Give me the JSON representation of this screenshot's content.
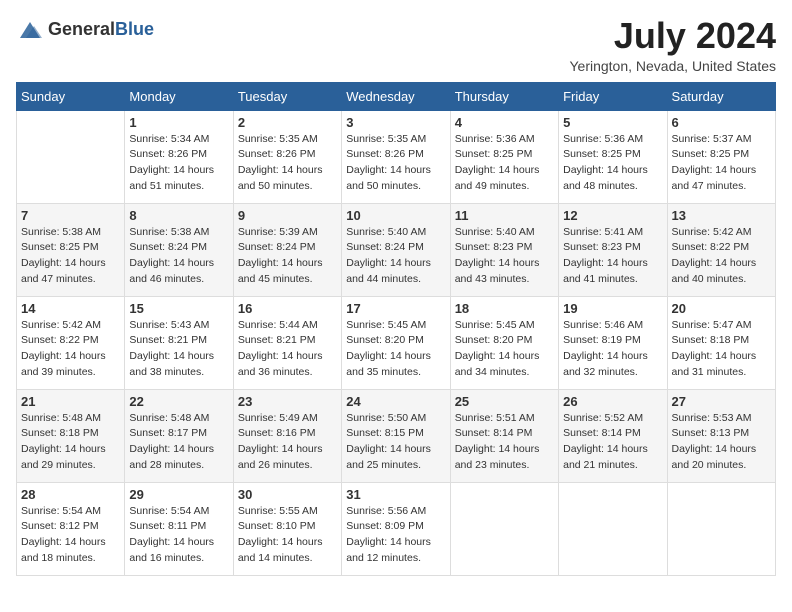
{
  "header": {
    "logo_general": "General",
    "logo_blue": "Blue",
    "month_year": "July 2024",
    "location": "Yerington, Nevada, United States"
  },
  "days_of_week": [
    "Sunday",
    "Monday",
    "Tuesday",
    "Wednesday",
    "Thursday",
    "Friday",
    "Saturday"
  ],
  "weeks": [
    [
      {
        "day": "",
        "sunrise": "",
        "sunset": "",
        "daylight": ""
      },
      {
        "day": "1",
        "sunrise": "Sunrise: 5:34 AM",
        "sunset": "Sunset: 8:26 PM",
        "daylight": "Daylight: 14 hours and 51 minutes."
      },
      {
        "day": "2",
        "sunrise": "Sunrise: 5:35 AM",
        "sunset": "Sunset: 8:26 PM",
        "daylight": "Daylight: 14 hours and 50 minutes."
      },
      {
        "day": "3",
        "sunrise": "Sunrise: 5:35 AM",
        "sunset": "Sunset: 8:26 PM",
        "daylight": "Daylight: 14 hours and 50 minutes."
      },
      {
        "day": "4",
        "sunrise": "Sunrise: 5:36 AM",
        "sunset": "Sunset: 8:25 PM",
        "daylight": "Daylight: 14 hours and 49 minutes."
      },
      {
        "day": "5",
        "sunrise": "Sunrise: 5:36 AM",
        "sunset": "Sunset: 8:25 PM",
        "daylight": "Daylight: 14 hours and 48 minutes."
      },
      {
        "day": "6",
        "sunrise": "Sunrise: 5:37 AM",
        "sunset": "Sunset: 8:25 PM",
        "daylight": "Daylight: 14 hours and 47 minutes."
      }
    ],
    [
      {
        "day": "7",
        "sunrise": "Sunrise: 5:38 AM",
        "sunset": "Sunset: 8:25 PM",
        "daylight": "Daylight: 14 hours and 47 minutes."
      },
      {
        "day": "8",
        "sunrise": "Sunrise: 5:38 AM",
        "sunset": "Sunset: 8:24 PM",
        "daylight": "Daylight: 14 hours and 46 minutes."
      },
      {
        "day": "9",
        "sunrise": "Sunrise: 5:39 AM",
        "sunset": "Sunset: 8:24 PM",
        "daylight": "Daylight: 14 hours and 45 minutes."
      },
      {
        "day": "10",
        "sunrise": "Sunrise: 5:40 AM",
        "sunset": "Sunset: 8:24 PM",
        "daylight": "Daylight: 14 hours and 44 minutes."
      },
      {
        "day": "11",
        "sunrise": "Sunrise: 5:40 AM",
        "sunset": "Sunset: 8:23 PM",
        "daylight": "Daylight: 14 hours and 43 minutes."
      },
      {
        "day": "12",
        "sunrise": "Sunrise: 5:41 AM",
        "sunset": "Sunset: 8:23 PM",
        "daylight": "Daylight: 14 hours and 41 minutes."
      },
      {
        "day": "13",
        "sunrise": "Sunrise: 5:42 AM",
        "sunset": "Sunset: 8:22 PM",
        "daylight": "Daylight: 14 hours and 40 minutes."
      }
    ],
    [
      {
        "day": "14",
        "sunrise": "Sunrise: 5:42 AM",
        "sunset": "Sunset: 8:22 PM",
        "daylight": "Daylight: 14 hours and 39 minutes."
      },
      {
        "day": "15",
        "sunrise": "Sunrise: 5:43 AM",
        "sunset": "Sunset: 8:21 PM",
        "daylight": "Daylight: 14 hours and 38 minutes."
      },
      {
        "day": "16",
        "sunrise": "Sunrise: 5:44 AM",
        "sunset": "Sunset: 8:21 PM",
        "daylight": "Daylight: 14 hours and 36 minutes."
      },
      {
        "day": "17",
        "sunrise": "Sunrise: 5:45 AM",
        "sunset": "Sunset: 8:20 PM",
        "daylight": "Daylight: 14 hours and 35 minutes."
      },
      {
        "day": "18",
        "sunrise": "Sunrise: 5:45 AM",
        "sunset": "Sunset: 8:20 PM",
        "daylight": "Daylight: 14 hours and 34 minutes."
      },
      {
        "day": "19",
        "sunrise": "Sunrise: 5:46 AM",
        "sunset": "Sunset: 8:19 PM",
        "daylight": "Daylight: 14 hours and 32 minutes."
      },
      {
        "day": "20",
        "sunrise": "Sunrise: 5:47 AM",
        "sunset": "Sunset: 8:18 PM",
        "daylight": "Daylight: 14 hours and 31 minutes."
      }
    ],
    [
      {
        "day": "21",
        "sunrise": "Sunrise: 5:48 AM",
        "sunset": "Sunset: 8:18 PM",
        "daylight": "Daylight: 14 hours and 29 minutes."
      },
      {
        "day": "22",
        "sunrise": "Sunrise: 5:48 AM",
        "sunset": "Sunset: 8:17 PM",
        "daylight": "Daylight: 14 hours and 28 minutes."
      },
      {
        "day": "23",
        "sunrise": "Sunrise: 5:49 AM",
        "sunset": "Sunset: 8:16 PM",
        "daylight": "Daylight: 14 hours and 26 minutes."
      },
      {
        "day": "24",
        "sunrise": "Sunrise: 5:50 AM",
        "sunset": "Sunset: 8:15 PM",
        "daylight": "Daylight: 14 hours and 25 minutes."
      },
      {
        "day": "25",
        "sunrise": "Sunrise: 5:51 AM",
        "sunset": "Sunset: 8:14 PM",
        "daylight": "Daylight: 14 hours and 23 minutes."
      },
      {
        "day": "26",
        "sunrise": "Sunrise: 5:52 AM",
        "sunset": "Sunset: 8:14 PM",
        "daylight": "Daylight: 14 hours and 21 minutes."
      },
      {
        "day": "27",
        "sunrise": "Sunrise: 5:53 AM",
        "sunset": "Sunset: 8:13 PM",
        "daylight": "Daylight: 14 hours and 20 minutes."
      }
    ],
    [
      {
        "day": "28",
        "sunrise": "Sunrise: 5:54 AM",
        "sunset": "Sunset: 8:12 PM",
        "daylight": "Daylight: 14 hours and 18 minutes."
      },
      {
        "day": "29",
        "sunrise": "Sunrise: 5:54 AM",
        "sunset": "Sunset: 8:11 PM",
        "daylight": "Daylight: 14 hours and 16 minutes."
      },
      {
        "day": "30",
        "sunrise": "Sunrise: 5:55 AM",
        "sunset": "Sunset: 8:10 PM",
        "daylight": "Daylight: 14 hours and 14 minutes."
      },
      {
        "day": "31",
        "sunrise": "Sunrise: 5:56 AM",
        "sunset": "Sunset: 8:09 PM",
        "daylight": "Daylight: 14 hours and 12 minutes."
      },
      {
        "day": "",
        "sunrise": "",
        "sunset": "",
        "daylight": ""
      },
      {
        "day": "",
        "sunrise": "",
        "sunset": "",
        "daylight": ""
      },
      {
        "day": "",
        "sunrise": "",
        "sunset": "",
        "daylight": ""
      }
    ]
  ]
}
